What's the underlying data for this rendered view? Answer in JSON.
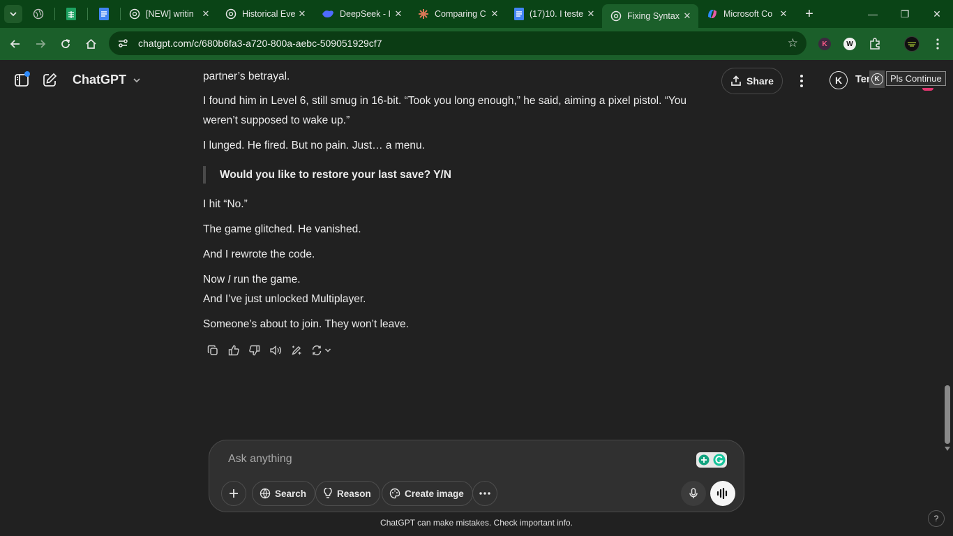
{
  "browser": {
    "tabs": [
      {
        "label": "[NEW] writin",
        "icon": "chatgpt-icon"
      },
      {
        "label": "Historical Eve",
        "icon": "chatgpt-icon"
      },
      {
        "label": "DeepSeek - I",
        "icon": "deepseek-icon"
      },
      {
        "label": "Comparing C",
        "icon": "claude-icon"
      },
      {
        "label": "(17)10. I teste",
        "icon": "docs-icon"
      },
      {
        "label": "Fixing Syntax",
        "icon": "chatgpt-icon"
      },
      {
        "label": "Microsoft Co",
        "icon": "copilot-icon"
      }
    ],
    "url": "chatgpt.com/c/680b6fa3-a720-800a-aebc-509051929cf7",
    "ext_k": "K",
    "ext_w": "W"
  },
  "app": {
    "title": "ChatGPT",
    "share_label": "Share",
    "user_initial": "K",
    "user_name_partial": "Ten",
    "tooltip_initial": "K",
    "tooltip": "Pls Continue"
  },
  "conversation": {
    "line_top": "partner’s betrayal.",
    "para1": "I found him in Level 6, still smug in 16-bit. “Took you long enough,” he said, aiming a pixel pistol. “You weren’t supposed to wake up.”",
    "para2": "I lunged. He fired. But no pain. Just… a menu.",
    "quote": "Would you like to restore your last save? Y/N",
    "para3": "I hit “No.”",
    "para4": "The game glitched. He vanished.",
    "para5": "And I rewrote the code.",
    "para6a_pre": "Now ",
    "para6a_em": "I",
    "para6a_post": " run the game.",
    "para6b": "And I’ve just unlocked Multiplayer.",
    "para7": "Someone’s about to join. They won’t leave."
  },
  "composer": {
    "placeholder": "Ask anything",
    "search_label": "Search",
    "reason_label": "Reason",
    "create_image_label": "Create image"
  },
  "footer": {
    "disclaimer": "ChatGPT can make mistakes. Check important info.",
    "help": "?"
  },
  "colors": {
    "chrome_green": "#0a4416",
    "toolbar_green": "#1b5f2a",
    "background": "#212121",
    "composer": "#303030"
  }
}
